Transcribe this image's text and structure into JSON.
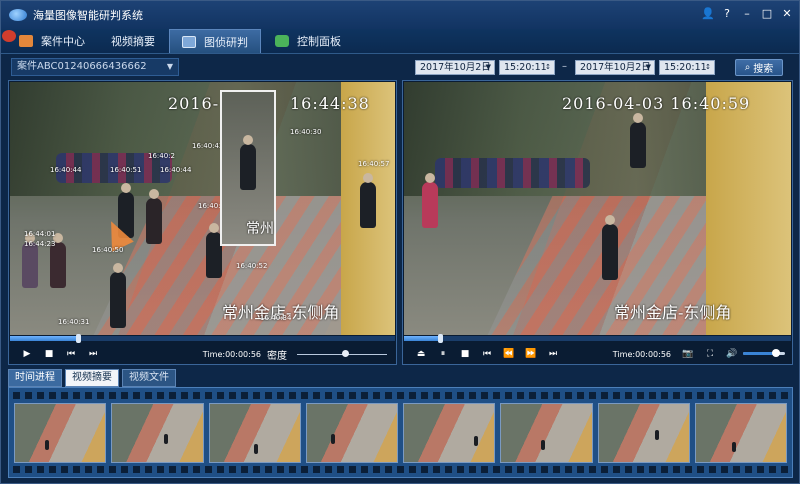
{
  "app": {
    "title": "海量图像智能研判系统"
  },
  "window_controls": [
    "user-icon",
    "help-icon",
    "minimize-icon",
    "maximize-icon",
    "close-icon"
  ],
  "tabs": [
    {
      "label": "案件中心",
      "icon": "case-icon",
      "active": false
    },
    {
      "label": "视频摘要",
      "icon": "video-summary-icon",
      "active": false
    },
    {
      "label": "图侦研判",
      "icon": "frame-icon",
      "active": true
    },
    {
      "label": "控制面板",
      "icon": "control-panel-icon",
      "active": false
    }
  ],
  "filter": {
    "case_id": "案件ABC01240666436662",
    "start_date": "2017年10月2日",
    "start_time": "15:20:11",
    "end_date": "2017年10月2日",
    "end_time": "15:20:11",
    "separator": "–",
    "search_label": "搜索"
  },
  "left_player": {
    "osd_time": "2016-",
    "osd_time2": "16:44:38",
    "crop_loc": "常州",
    "osd_loc": "常州金店-东侧角",
    "time": "Time:00:00:56",
    "density_label": "密度",
    "progress": 0.18,
    "density": 0.53,
    "tags": [
      "16:40:44",
      "16:40:2",
      "16:40:42",
      "16:40:44",
      "16:40:50",
      "16:40:51",
      "16:44:01",
      "16:44:23",
      "16:40:52",
      "16:40:47",
      "16:40:57",
      "16:40:31",
      "16:40:34",
      "16:40:30"
    ]
  },
  "right_player": {
    "osd_time": "2016-04-03  16:40:59",
    "osd_loc": "常州金店-东侧角",
    "time": "Time:00:00:56",
    "progress": 0.095,
    "volume": 0.75
  },
  "bottom_tabs": [
    {
      "label": "时间进程",
      "active": false
    },
    {
      "label": "视频摘要",
      "active": true
    },
    {
      "label": "视频文件",
      "active": false
    }
  ],
  "thumbnails_count": 8
}
